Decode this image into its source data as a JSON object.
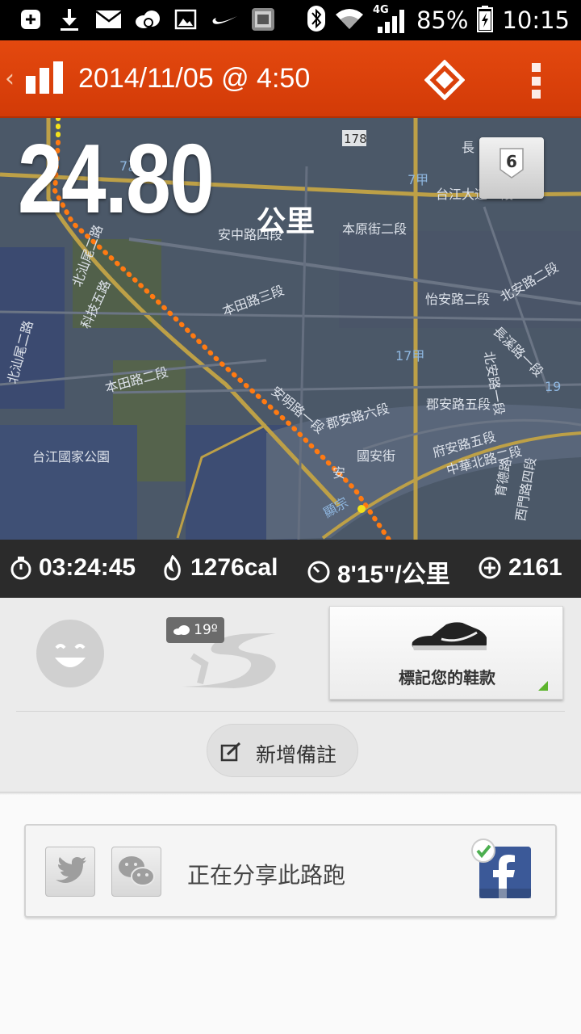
{
  "status_bar": {
    "battery": "85%",
    "time": "10:15",
    "network": "4G"
  },
  "app_bar": {
    "title": "2014/11/05 @ 4:50"
  },
  "run": {
    "distance": "24.80",
    "unit": "公里",
    "level": "6"
  },
  "stats": {
    "duration": "03:24:45",
    "calories": "1276cal",
    "pace": "8'15\"/公里",
    "fuel": "2161"
  },
  "gear": {
    "temperature": "19º",
    "shoe_label": "標記您的鞋款",
    "note_label": "新增備註"
  },
  "share": {
    "label": "正在分享此路跑"
  },
  "map_labels": [
    "178",
    "長",
    "7乙",
    "7甲",
    "台江大道二段",
    "本原街二段",
    "安中路四段",
    "北汕尾二路",
    "科技五路",
    "本田路三段",
    "怡安路二段",
    "北安路二段",
    "長溪路一段",
    "北安路一段",
    "17甲",
    "本田路二段",
    "安明路一段",
    "郡安路五段",
    "郡安路六段",
    "國安街",
    "府安路五段",
    "中華北路二段",
    "台江國家公園",
    "北汕尾二路",
    "育德路",
    "西門路四段",
    "安",
    "顯宗",
    "19"
  ],
  "colors": {
    "accent": "#e04510",
    "stats_bg": "#2b2b2b",
    "route": "#ff7a12"
  }
}
